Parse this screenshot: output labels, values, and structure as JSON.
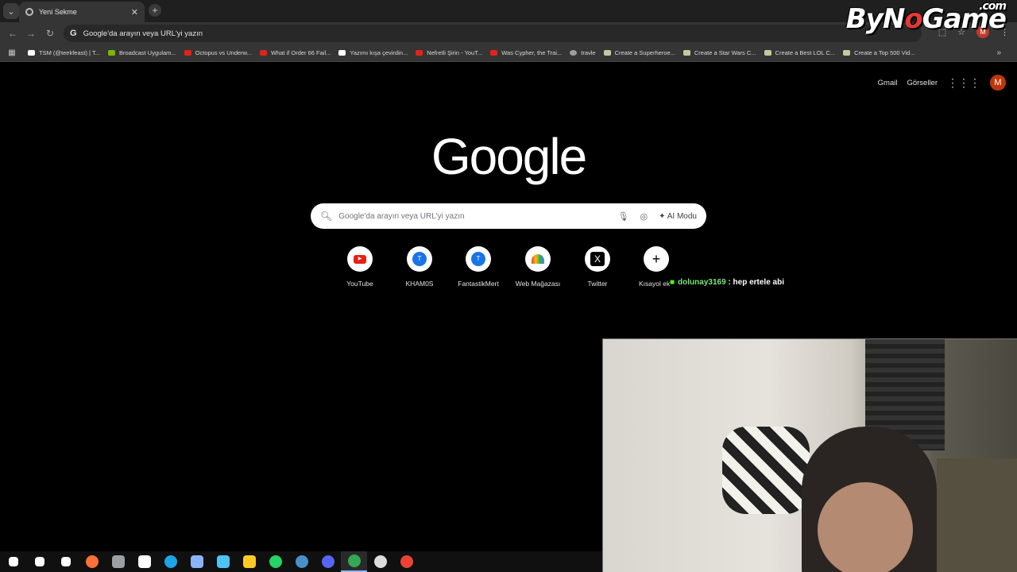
{
  "browser": {
    "tab": {
      "title": "Yeni Sekme"
    },
    "omnibox": {
      "placeholder": "Google'da arayın veya URL'yi yazın",
      "avatar_letter": "M"
    },
    "bookmarks": [
      {
        "label": "TSM (@teekfeast) | T...",
        "color": "#ffffff"
      },
      {
        "label": "Broadcast Uygulam...",
        "color": "#76b900"
      },
      {
        "label": "Octopus vs Underw...",
        "color": "#e62117"
      },
      {
        "label": "What if Order 66 Fail...",
        "color": "#e62117"
      },
      {
        "label": "Yazımı kışa çevirdin...",
        "color": "#ffffff"
      },
      {
        "label": "Nefretli Şirin - YouT...",
        "color": "#e62117"
      },
      {
        "label": "Was Cypher, the Trai...",
        "color": "#e62117"
      },
      {
        "label": "travle",
        "color": "#9e9e9e"
      },
      {
        "label": "Create a Superheroe...",
        "color": "#c8c8a0"
      },
      {
        "label": "Create a Star Wars C...",
        "color": "#c8c8a0"
      },
      {
        "label": "Create a Best LOL C...",
        "color": "#c8c8a0"
      },
      {
        "label": "Create a Top 500 Vid...",
        "color": "#c8c8a0"
      }
    ]
  },
  "overlay": {
    "logo_main_a": "ByN",
    "logo_o": "o",
    "logo_main_b": "Game",
    "logo_dotcom": ".com"
  },
  "google": {
    "header": {
      "gmail": "Gmail",
      "images": "Görseller",
      "avatar_letter": "M"
    },
    "logo": "Google",
    "search": {
      "placeholder": "Google'da arayın veya URL'yi yazın",
      "ai_mode": "AI Modu"
    },
    "shortcuts": [
      {
        "label": "YouTube",
        "icon": "youtube-icon"
      },
      {
        "label": "KHAM0S",
        "icon": "letter-t-icon",
        "letter": "T"
      },
      {
        "label": "FantastikMert",
        "icon": "letter-t-icon",
        "letter": "T"
      },
      {
        "label": "Web Mağazası",
        "icon": "web-store-icon"
      },
      {
        "label": "Twitter",
        "icon": "x-icon",
        "letter": "X"
      },
      {
        "label": "Kısayol ek",
        "icon": "plus-icon",
        "letter": "+"
      }
    ]
  },
  "chat": {
    "username": "dolunay3169",
    "message": ": hep ertele abi"
  },
  "taskbar": {
    "items": [
      {
        "name": "start-icon",
        "color": "#ffffff"
      },
      {
        "name": "search-icon",
        "color": "#ffffff"
      },
      {
        "name": "task-view-icon",
        "color": "#ffffff"
      },
      {
        "name": "firefox-icon",
        "color": "#ff7139"
      },
      {
        "name": "app-icon",
        "color": "#9aa0a6"
      },
      {
        "name": "store-icon",
        "color": "#ffffff"
      },
      {
        "name": "edge-icon",
        "color": "#1fa3e8"
      },
      {
        "name": "app-icon",
        "color": "#8ab4f8"
      },
      {
        "name": "app-icon",
        "color": "#4fc3f7"
      },
      {
        "name": "folder-icon",
        "color": "#ffca28"
      },
      {
        "name": "whatsapp-icon",
        "color": "#25d366"
      },
      {
        "name": "steam-icon",
        "color": "#4a90c8"
      },
      {
        "name": "discord-icon",
        "color": "#5865f2"
      },
      {
        "name": "chrome-icon",
        "color": "#34a853"
      },
      {
        "name": "obs-icon",
        "color": "#dddddd"
      },
      {
        "name": "chrome-icon",
        "color": "#ea4335"
      }
    ]
  }
}
